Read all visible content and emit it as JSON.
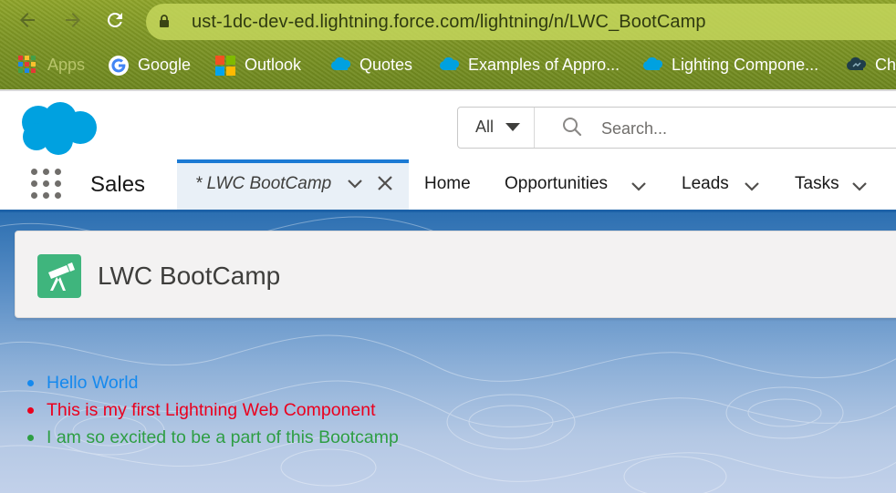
{
  "browser": {
    "url": "ust-1dc-dev-ed.lightning.force.com/lightning/n/LWC_BootCamp",
    "bookmarks": [
      {
        "label": "Apps",
        "icon": "apps-grid-icon"
      },
      {
        "label": "Google",
        "icon": "google-icon"
      },
      {
        "label": "Outlook",
        "icon": "outlook-icon"
      },
      {
        "label": "Quotes",
        "icon": "salesforce-cloud-icon"
      },
      {
        "label": "Examples of Appro...",
        "icon": "salesforce-cloud-icon"
      },
      {
        "label": "Lighting Compone...",
        "icon": "salesforce-cloud-icon"
      },
      {
        "label": "Ch",
        "icon": "cloud-icon"
      }
    ]
  },
  "header": {
    "search_scope": "All",
    "search_placeholder": "Search..."
  },
  "nav": {
    "app_name": "Sales",
    "active_tab": "* LWC BootCamp",
    "items": [
      "Home",
      "Opportunities",
      "Leads",
      "Tasks"
    ]
  },
  "page": {
    "title": "LWC BootCamp",
    "list": [
      {
        "text": "Hello World",
        "color": "#1589ee"
      },
      {
        "text": "This is my first Lightning Web Component",
        "color": "#ea001e"
      },
      {
        "text": "I am so excited to be a part of this Bootcamp",
        "color": "#2e9e44"
      }
    ]
  },
  "colors": {
    "brand_blue": "#1b7ad4",
    "salesforce_cloud": "#00a1e0",
    "page_icon_green": "#3fb57d"
  }
}
